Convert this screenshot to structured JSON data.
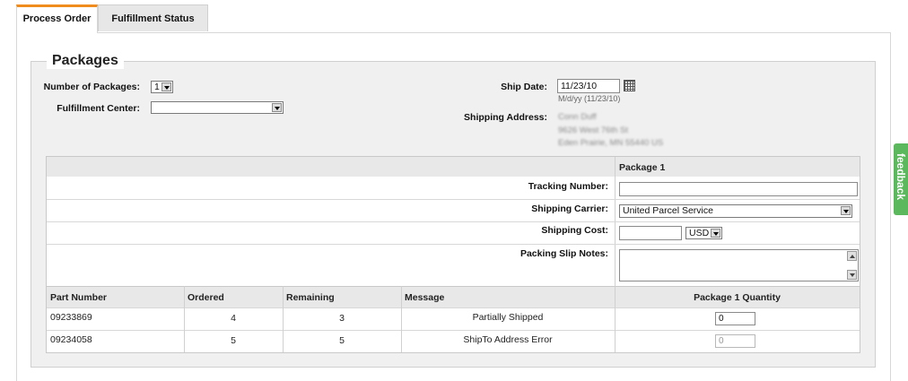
{
  "tabs": [
    {
      "label": "Process Order",
      "active": true
    },
    {
      "label": "Fulfillment Status",
      "active": false
    }
  ],
  "packages": {
    "title": "Packages",
    "num_packages_label": "Number of Packages:",
    "num_packages_value": "1",
    "fulfillment_center_label": "Fulfillment Center:",
    "fulfillment_center_value": "",
    "ship_date_label": "Ship Date:",
    "ship_date_value": "11/23/10",
    "ship_date_hint": "M/d/yy (11/23/10)",
    "shipping_address_label": "Shipping Address:",
    "shipping_address_lines": [
      "Conn Duff",
      "9626 West 76th St",
      "Eden Prairie, MN 55440 US"
    ]
  },
  "package_table": {
    "column_header": "Package 1",
    "tracking_label": "Tracking Number:",
    "tracking_value": "",
    "carrier_label": "Shipping Carrier:",
    "carrier_value": "United Parcel Service",
    "cost_label": "Shipping Cost:",
    "cost_value": "",
    "currency_value": "USD",
    "notes_label": "Packing Slip Notes:",
    "notes_value": ""
  },
  "parts_table": {
    "headers": [
      "Part Number",
      "Ordered",
      "Remaining",
      "Message",
      "Package 1 Quantity"
    ],
    "rows": [
      {
        "part": "09233869",
        "ordered": "4",
        "remaining": "3",
        "message": "Partially Shipped",
        "qty": "0",
        "qty_disabled": false
      },
      {
        "part": "09234058",
        "ordered": "5",
        "remaining": "5",
        "message": "ShipTo Address Error",
        "qty": "0",
        "qty_disabled": true
      }
    ]
  },
  "feedback_label": "feedback",
  "colors": {
    "tab_accent": "#f08c1e",
    "feedback": "#5cb85c"
  }
}
